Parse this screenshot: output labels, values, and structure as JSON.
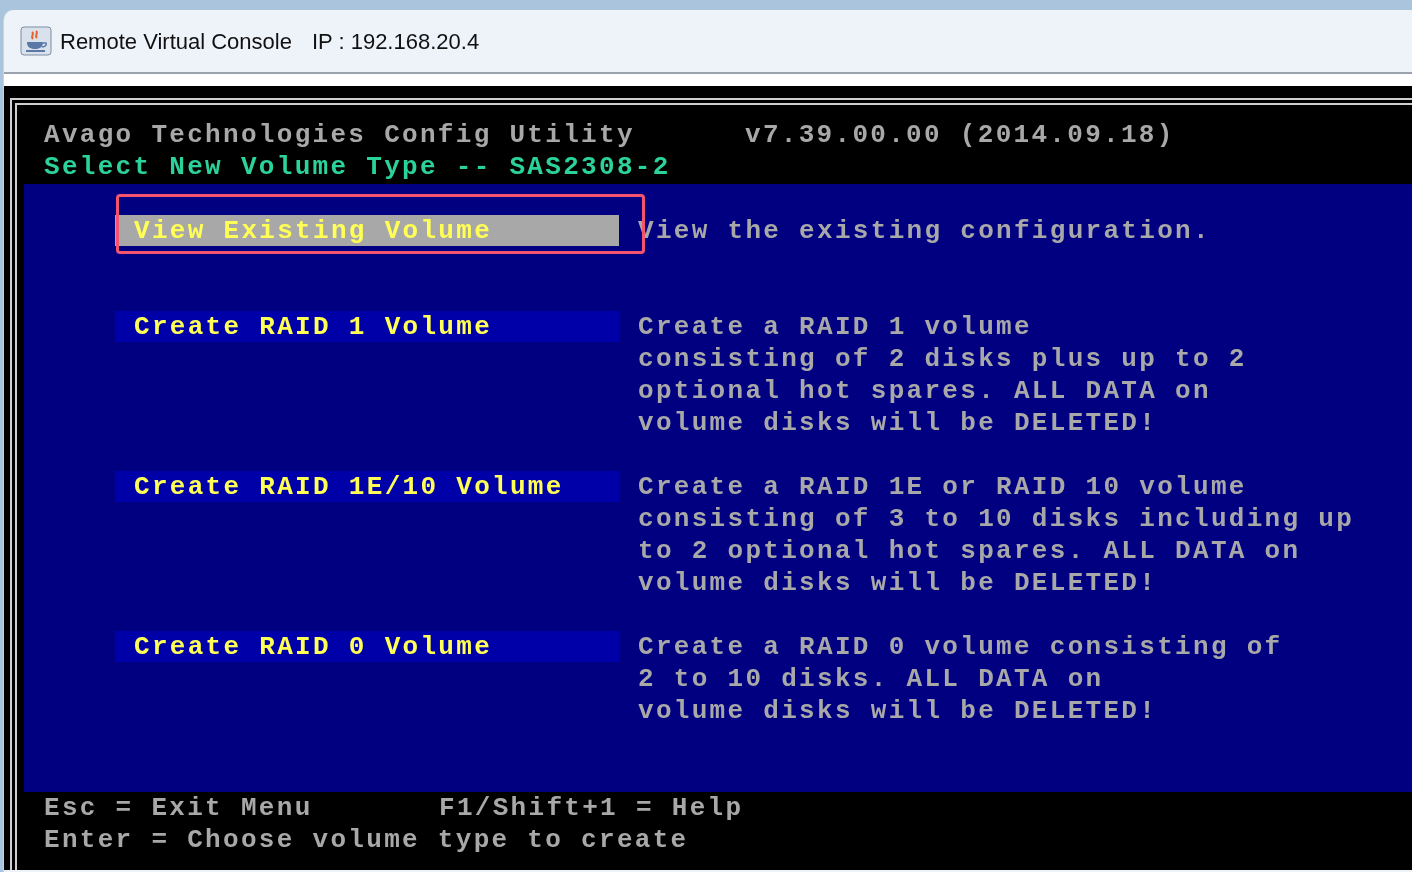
{
  "window": {
    "title": "Remote Virtual Console",
    "ip": "IP : 192.168.20.4"
  },
  "header": {
    "utility": "Avago Technologies Config Utility",
    "version": "v7.39.00.00 (2014.09.18)",
    "screen_title": "Select New Volume Type -- SAS2308-2"
  },
  "menu": [
    {
      "label": "View Existing Volume",
      "selected": true,
      "highlighted": true,
      "description": [
        "View the existing configuration."
      ]
    },
    {
      "label": "Create RAID 1 Volume",
      "selected": false,
      "highlighted": false,
      "description": [
        "Create a RAID 1 volume",
        "consisting of 2 disks plus up to 2",
        "optional hot spares. ALL DATA on",
        "volume disks will be DELETED!"
      ]
    },
    {
      "label": "Create RAID 1E/10 Volume",
      "selected": false,
      "highlighted": false,
      "description": [
        "Create a RAID 1E or RAID 10 volume",
        "consisting of 3 to 10 disks including up",
        "to 2 optional hot spares. ALL DATA on",
        "volume disks will be DELETED!"
      ]
    },
    {
      "label": "Create RAID 0 Volume",
      "selected": false,
      "highlighted": false,
      "description": [
        "Create a RAID 0 volume consisting of",
        "2 to 10 disks. ALL DATA on",
        "volume disks will be DELETED!"
      ]
    }
  ],
  "footer": {
    "lines": [
      [
        "Esc = Exit Menu",
        "F1/Shift+1 = Help"
      ],
      [
        "Enter = Choose volume type to create"
      ]
    ]
  }
}
